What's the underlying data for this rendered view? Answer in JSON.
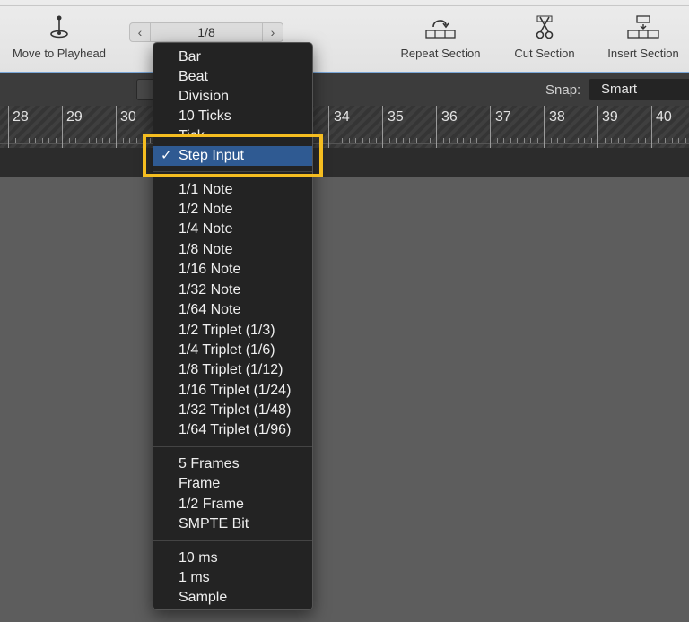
{
  "toolbar": {
    "move_to_playhead": "Move to Playhead",
    "stepper_value": "1/8",
    "repeat_section": "Repeat Section",
    "cut_section": "Cut Section",
    "insert_section": "Insert Section"
  },
  "snap": {
    "label": "Snap:",
    "value": "Smart"
  },
  "ruler": {
    "bars": [
      "28",
      "29",
      "30",
      "34",
      "35",
      "36",
      "37",
      "38",
      "39",
      "40"
    ]
  },
  "menu": {
    "items_group1": [
      "Bar",
      "Beat",
      "Division",
      "10 Ticks",
      "Tick"
    ],
    "selected": "Step Input",
    "check_glyph": "✓",
    "items_group2": [
      "1/1 Note",
      "1/2 Note",
      "1/4 Note",
      "1/8 Note",
      "1/16 Note",
      "1/32 Note",
      "1/64 Note",
      "1/2 Triplet (1/3)",
      "1/4 Triplet (1/6)",
      "1/8 Triplet (1/12)",
      "1/16 Triplet (1/24)",
      "1/32 Triplet (1/48)",
      "1/64 Triplet (1/96)"
    ],
    "items_group3": [
      "5 Frames",
      "Frame",
      "1/2 Frame",
      "SMPTE Bit"
    ],
    "items_group4": [
      "10 ms",
      "1 ms",
      "Sample"
    ]
  },
  "colors": {
    "highlight": "#f5bd20",
    "selection": "#2f5a92",
    "menu_bg": "#232323"
  }
}
